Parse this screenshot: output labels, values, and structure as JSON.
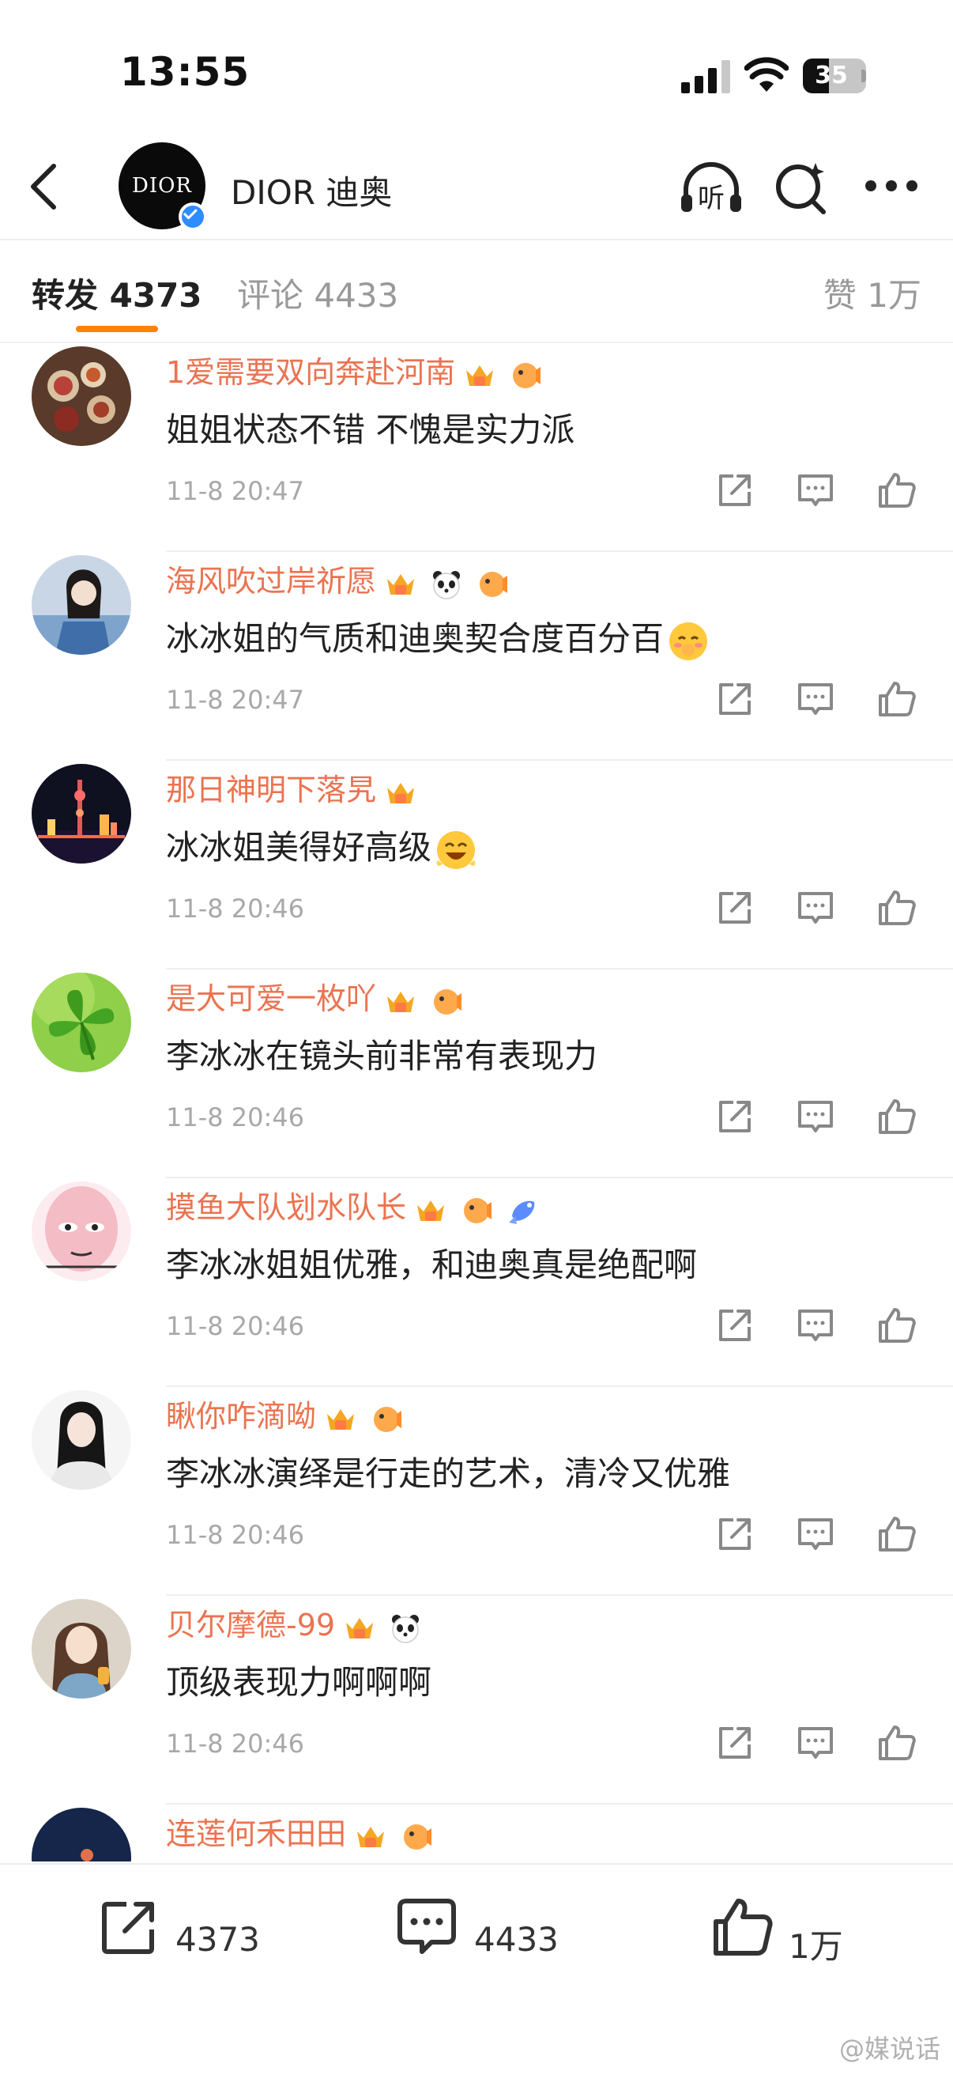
{
  "status": {
    "time": "13:55",
    "battery": "35",
    "battery_level": 0.35
  },
  "header": {
    "title": "DIOR 迪奥",
    "avatar_text": "DIOR"
  },
  "tabs": {
    "repost": "转发 4373",
    "comment": "评论 4433",
    "like": "赞 1万"
  },
  "comments": [
    {
      "name": "1爱需要双向奔赴河南",
      "text": "姐姐状态不错 不愧是实力派",
      "time": "11-8 20:47",
      "badges": [
        "crown",
        "fish"
      ]
    },
    {
      "name": "海风吹过岸祈愿",
      "text": "冰冰姐的气质和迪奥契合度百分百",
      "time": "11-8 20:47",
      "badges": [
        "crown",
        "panda",
        "fish"
      ],
      "emoji": "shy-face"
    },
    {
      "name": "那日神明下落旯",
      "text": "冰冰姐美得好高级",
      "time": "11-8 20:46",
      "badges": [
        "crown"
      ],
      "emoji": "happy-face"
    },
    {
      "name": "是大可爱一枚吖",
      "text": "李冰冰在镜头前非常有表现力",
      "time": "11-8 20:46",
      "badges": [
        "crown",
        "fish"
      ]
    },
    {
      "name": "摸鱼大队划水队长",
      "text": "李冰冰姐姐优雅，和迪奥真是绝配啊",
      "time": "11-8 20:46",
      "badges": [
        "crown",
        "fish",
        "blue-fish"
      ]
    },
    {
      "name": "瞅你咋滴呦",
      "text": "李冰冰演绎是行走的艺术，清冷又优雅",
      "time": "11-8 20:46",
      "badges": [
        "crown",
        "fish"
      ]
    },
    {
      "name": "贝尔摩德-99",
      "text": "顶级表现力啊啊啊",
      "time": "11-8 20:46",
      "badges": [
        "crown",
        "panda"
      ]
    },
    {
      "name": "连莲何禾田田",
      "text": "",
      "time": "",
      "badges": [
        "crown",
        "fish"
      ]
    }
  ],
  "bottom": {
    "repost_count": "4373",
    "comment_count": "4433",
    "like_count": "1万"
  },
  "watermark": "@媒说话",
  "colors": {
    "accent": "#ff8200",
    "username": "#eb7350",
    "muted": "#a8a8a8"
  }
}
